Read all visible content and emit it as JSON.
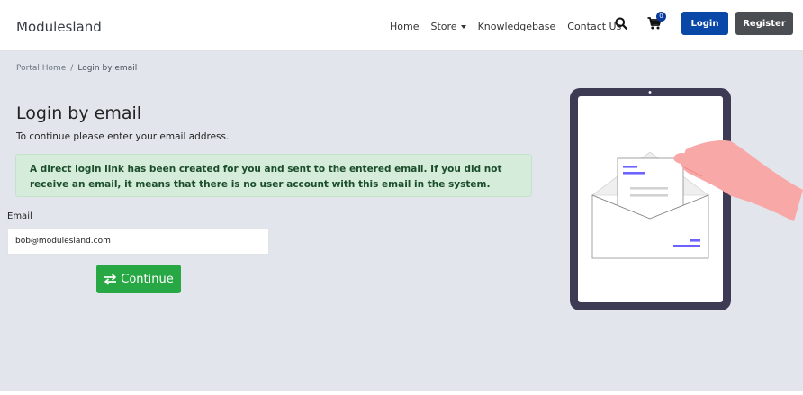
{
  "brand": "Modulesland",
  "nav": {
    "home": "Home",
    "store": "Store",
    "knowledgebase": "Knowledgebase",
    "contact": "Contact Us",
    "cart_count": "0",
    "login": "Login",
    "register": "Register"
  },
  "breadcrumb": {
    "home": "Portal Home",
    "separator": "/",
    "current": "Login by email"
  },
  "main": {
    "title": "Login by email",
    "subtitle": "To continue please enter your email address.",
    "alert": "A direct login link has been created for you and sent to the entered email. If you did not receive an email, it means that there is no user account with this email in the system.",
    "email_label": "Email",
    "email_value": "bob@modulesland.com",
    "continue_label": "Continue"
  },
  "colors": {
    "background": "#e2e6ec",
    "login_button": "#0a48a8",
    "register_button": "#4a4d52",
    "continue_button": "#28a745",
    "alert_bg": "#d4ecd9",
    "tablet_frame": "#3c3b53",
    "accent": "#6c63ff",
    "hand": "#f9a8a8"
  },
  "icons": {
    "search": "search-icon",
    "cart": "cart-icon",
    "continue": "exchange-arrows-icon"
  }
}
